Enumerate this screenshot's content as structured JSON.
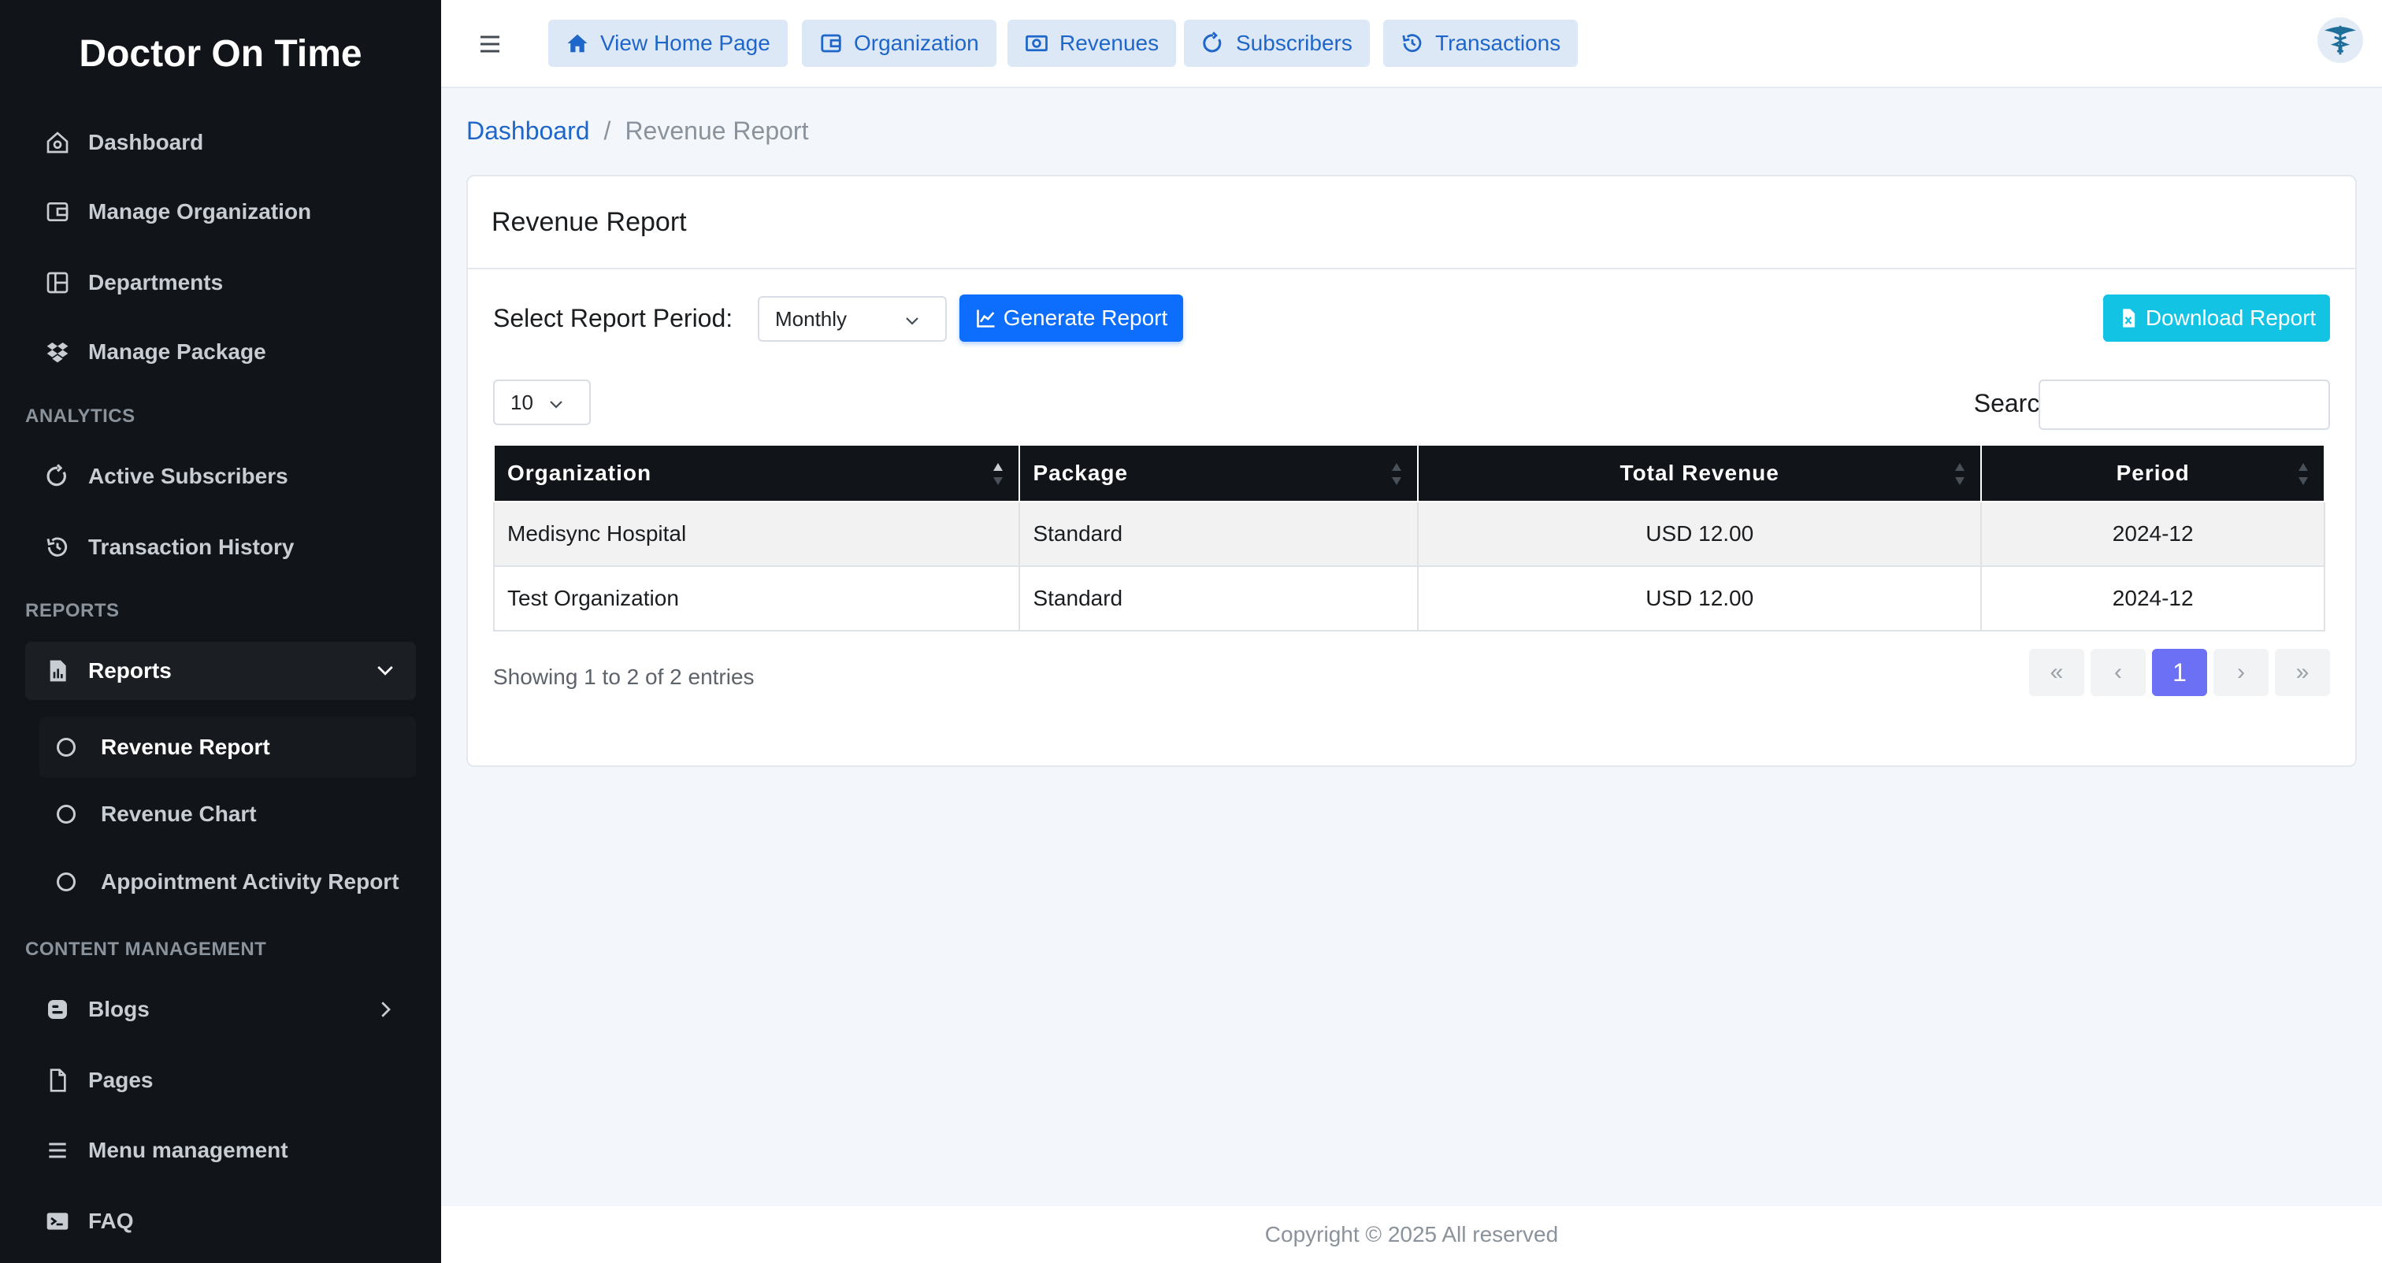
{
  "app": {
    "brand": "Doctor On Time"
  },
  "sidebar": {
    "items": [
      {
        "label": "Dashboard",
        "icon": "home-icon"
      },
      {
        "label": "Manage Organization",
        "icon": "wallet-icon"
      },
      {
        "label": "Departments",
        "icon": "layout-icon"
      },
      {
        "label": "Manage Package",
        "icon": "dropbox-icon"
      }
    ],
    "analytics_label": "ANALYTICS",
    "analytics": [
      {
        "label": "Active Subscribers",
        "icon": "refresh-icon"
      },
      {
        "label": "Transaction History",
        "icon": "history-icon"
      }
    ],
    "reports_label": "REPORTS",
    "reports": {
      "label": "Reports",
      "icon": "report-icon"
    },
    "report_children": [
      {
        "label": "Revenue Report"
      },
      {
        "label": "Revenue Chart"
      },
      {
        "label": "Appointment Activity Report"
      }
    ],
    "content_label": "CONTENT MANAGEMENT",
    "content": [
      {
        "label": "Blogs",
        "icon": "blog-icon"
      },
      {
        "label": "Pages",
        "icon": "file-icon"
      },
      {
        "label": "Menu management",
        "icon": "menu-icon"
      },
      {
        "label": "FAQ",
        "icon": "terminal-icon"
      }
    ]
  },
  "topbar": {
    "buttons": [
      {
        "label": "View Home Page",
        "icon": "home-icon"
      },
      {
        "label": "Organization",
        "icon": "wallet-icon"
      },
      {
        "label": "Revenues",
        "icon": "money-icon"
      },
      {
        "label": "Subscribers",
        "icon": "refresh-icon"
      },
      {
        "label": "Transactions",
        "icon": "history-icon"
      }
    ]
  },
  "breadcrumb": {
    "link": "Dashboard",
    "separator": "/",
    "current": "Revenue Report"
  },
  "card": {
    "title": "Revenue Report",
    "period_label": "Select Report Period:",
    "period_value": "Monthly",
    "generate_label": "Generate Report",
    "download_label": "Download Report",
    "page_length": "10",
    "search_label": "Search:",
    "search_value": ""
  },
  "table": {
    "headers": [
      "Organization",
      "Package",
      "Total Revenue",
      "Period"
    ],
    "rows": [
      [
        "Medisync Hospital",
        "Standard",
        "USD 12.00",
        "2024-12"
      ],
      [
        "Test Organization",
        "Standard",
        "USD 12.00",
        "2024-12"
      ]
    ]
  },
  "pagination": {
    "info": "Showing 1 to 2 of 2 entries",
    "first": "«",
    "prev": "‹",
    "current": "1",
    "next": "›",
    "last": "»"
  },
  "footer": {
    "copyright": "Copyright © 2025 All reserved"
  },
  "colors": {
    "sidebar_bg": "#111418",
    "primary": "#0d6efd",
    "info": "#12c3e4",
    "page_active": "#6c70f5"
  }
}
